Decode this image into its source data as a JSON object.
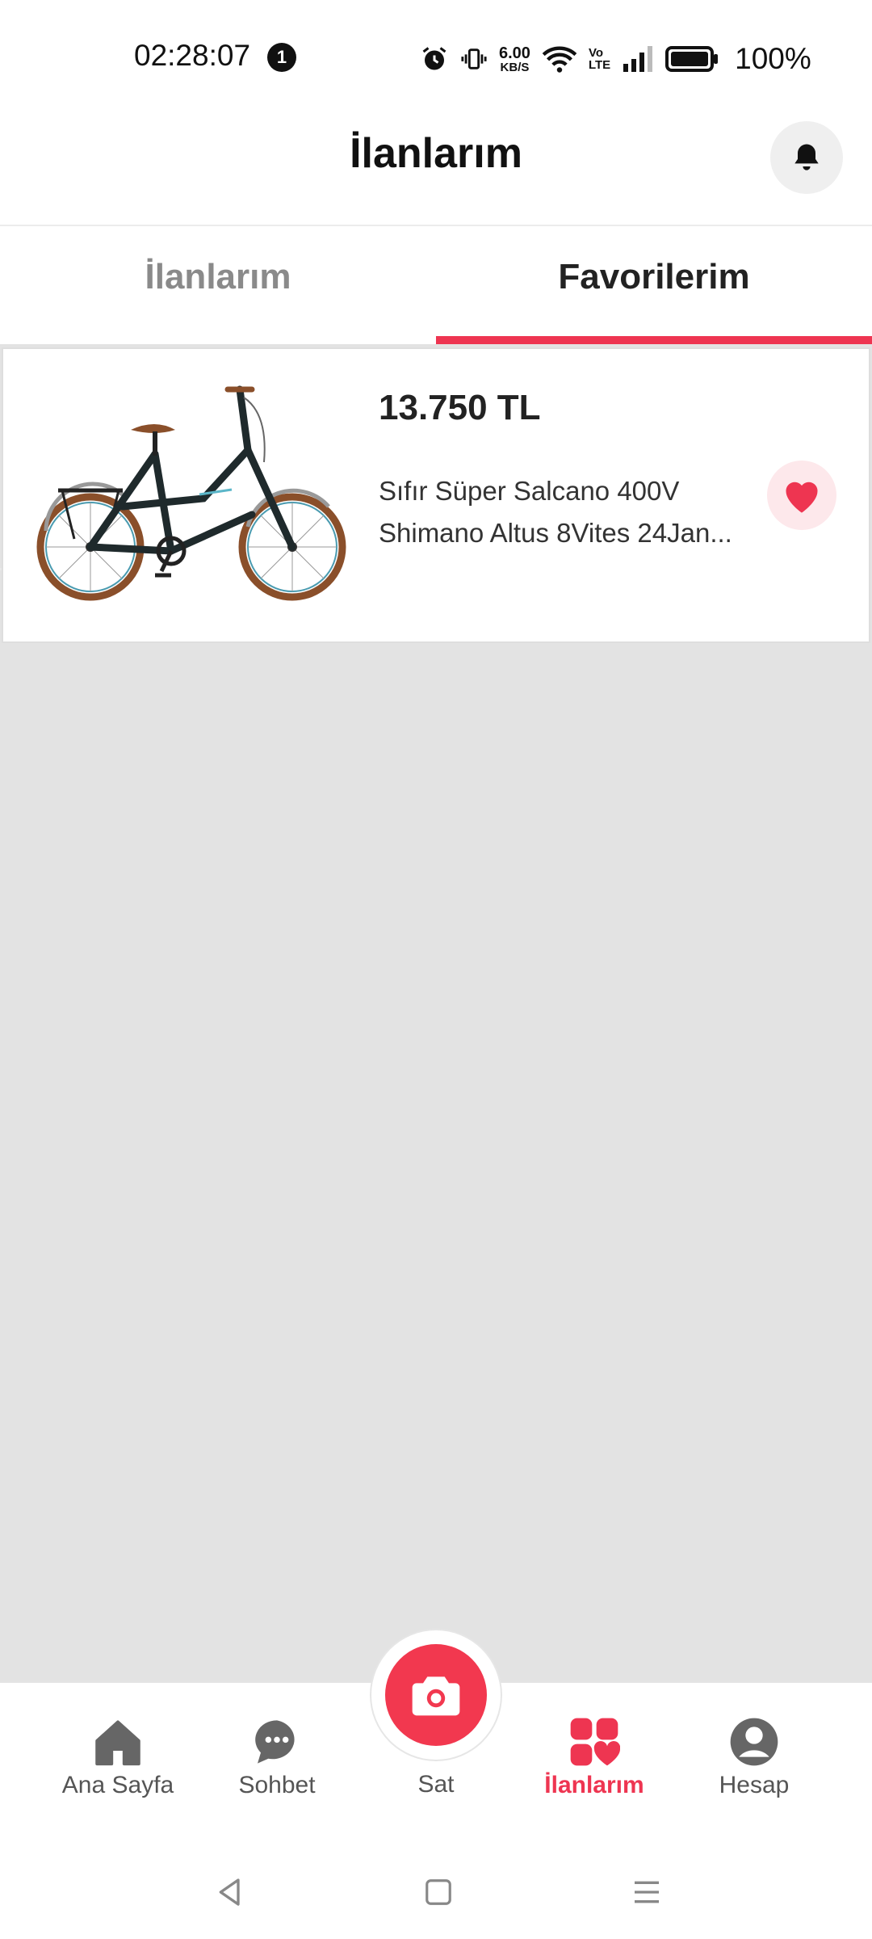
{
  "status_bar": {
    "time": "02:28:07",
    "notification_count": "1",
    "net_speed_value": "6.00",
    "net_speed_unit": "KB/S",
    "volte_top": "Vo",
    "volte_bottom": "LTE",
    "battery": "100%"
  },
  "header": {
    "title": "İlanlarım",
    "bell_icon": "bell-icon"
  },
  "tabs": [
    {
      "label": "İlanlarım",
      "active": false
    },
    {
      "label": "Favorilerim",
      "active": true
    }
  ],
  "listing": {
    "price": "13.750 TL",
    "title_line1": "Sıfır Süper Salcano 400V",
    "title_line2": "Shimano Altus 8Vites 24Jan...",
    "favorite_icon": "heart-icon",
    "favorited": true
  },
  "bottom_nav": {
    "items": [
      {
        "label": "Ana Sayfa",
        "icon": "home-icon"
      },
      {
        "label": "Sohbet",
        "icon": "chat-icon"
      },
      {
        "label": "Sat",
        "icon": "camera-icon"
      },
      {
        "label": "İlanlarım",
        "icon": "listings-heart-icon",
        "active": true
      },
      {
        "label": "Hesap",
        "icon": "account-icon"
      }
    ]
  },
  "colors": {
    "accent": "#ee3551",
    "background": "#e3e3e3"
  }
}
